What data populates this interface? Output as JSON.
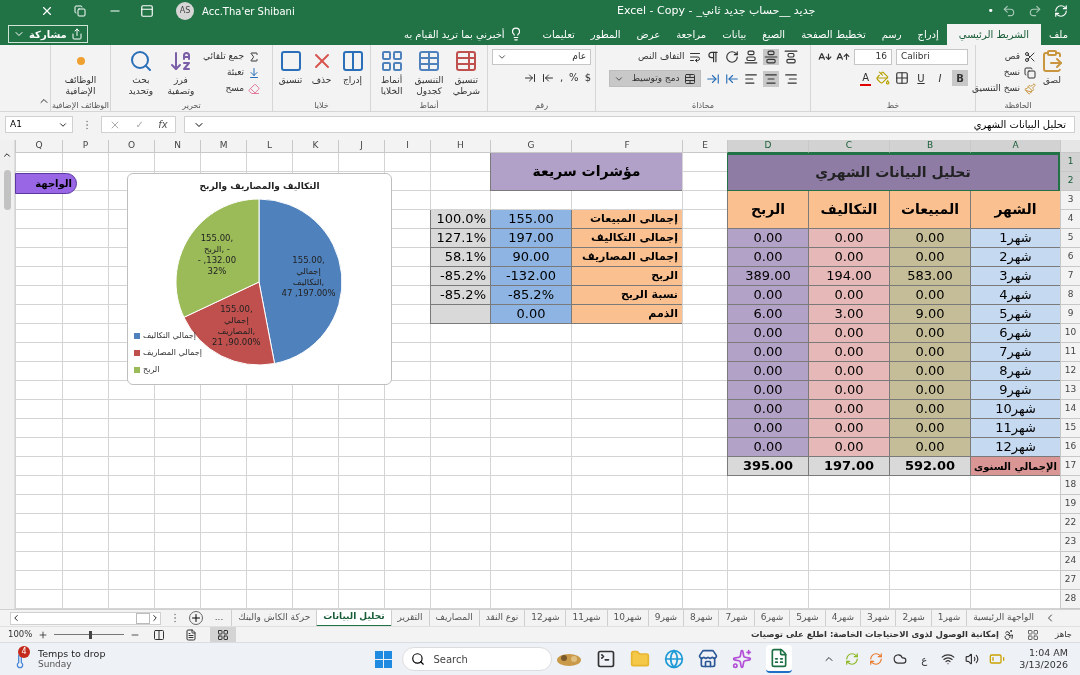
{
  "title_bar": {
    "app_title": "Excel - Copy -",
    "file_name": "جديد __حساب جديد ثاني_",
    "user_initials": "AS",
    "user_name": "Acc.Tha'er Shibani",
    "dot": "•"
  },
  "ribbon_tabs": [
    {
      "label": "ملف",
      "selected": false
    },
    {
      "label": "الشريط الرئيسي",
      "selected": true
    },
    {
      "label": "إدراج",
      "selected": false
    },
    {
      "label": "رسم",
      "selected": false
    },
    {
      "label": "تخطيط الصفحة",
      "selected": false
    },
    {
      "label": "الصيغ",
      "selected": false
    },
    {
      "label": "بيانات",
      "selected": false
    },
    {
      "label": "مراجعة",
      "selected": false
    },
    {
      "label": "عرض",
      "selected": false
    },
    {
      "label": "المطور",
      "selected": false
    },
    {
      "label": "تعليمات",
      "selected": false
    }
  ],
  "tell_me": "أخبرني بما تريد القيام به",
  "share_button": "مشاركة",
  "ribbon": {
    "clipboard": {
      "label": "الحافظة",
      "paste": "لصق",
      "cut": "قص",
      "copy": "نسخ",
      "format_painter": "نسخ التنسيق"
    },
    "font": {
      "label": "خط",
      "font_name": "Calibri",
      "font_size": "16",
      "bold": "B",
      "italic": "I",
      "underline": "U",
      "font_color": "A",
      "bold_selected": true
    },
    "alignment": {
      "label": "محاذاة",
      "wrap_text": "التفاف النص",
      "merge_center": "دمج وتوسيط",
      "merge_selected": true,
      "middle_selected": true,
      "center_selected": true
    },
    "number": {
      "label": "رقم",
      "format": "عام",
      "currency": "$",
      "percent": "%",
      "comma": ","
    },
    "styles": {
      "label": "أنماط",
      "conditional": "تنسيق شرطي",
      "as_table": "التنسيق كجدول",
      "cell_styles": "أنماط الخلايا"
    },
    "cells": {
      "label": "خلايا",
      "insert": "إدراج",
      "delete": "حذف",
      "format": "تنسيق"
    },
    "editing": {
      "label": "تحرير",
      "autosum": "جمع تلقائي",
      "fill": "تعبئة",
      "clear": "مسح",
      "sort_filter": "فرز وتصفية",
      "find_select": "بحث وتحديد"
    },
    "addins": {
      "label": "الوظائف الإضافية",
      "button": "الوظائف الإضافية"
    }
  },
  "formula_bar": {
    "name_box": "A1",
    "enter": "✓",
    "function": "fx",
    "formula": "تحليل البيانات الشهري"
  },
  "sheet": {
    "columns": [
      {
        "label": "A",
        "selected": true
      },
      {
        "label": "B",
        "selected": true
      },
      {
        "label": "C",
        "selected": true
      },
      {
        "label": "D",
        "selected": true
      },
      {
        "label": "E",
        "selected": false
      },
      {
        "label": "F",
        "selected": false
      },
      {
        "label": "G",
        "selected": false
      },
      {
        "label": "H",
        "selected": false
      },
      {
        "label": "I",
        "selected": false
      },
      {
        "label": "J",
        "selected": false
      },
      {
        "label": "K",
        "selected": false
      },
      {
        "label": "L",
        "selected": false
      },
      {
        "label": "M",
        "selected": false
      },
      {
        "label": "N",
        "selected": false
      },
      {
        "label": "O",
        "selected": false
      },
      {
        "label": "P",
        "selected": false
      },
      {
        "label": "Q",
        "selected": false
      }
    ],
    "rows": [
      {
        "label": "1",
        "selected": true
      },
      {
        "label": "2",
        "selected": true
      },
      {
        "label": "3",
        "selected": false
      },
      {
        "label": "4",
        "selected": false
      },
      {
        "label": "5",
        "selected": false
      },
      {
        "label": "6",
        "selected": false
      },
      {
        "label": "7",
        "selected": false
      },
      {
        "label": "8",
        "selected": false
      },
      {
        "label": "9",
        "selected": false
      },
      {
        "label": "10",
        "selected": false
      },
      {
        "label": "11",
        "selected": false
      },
      {
        "label": "12",
        "selected": false
      },
      {
        "label": "13",
        "selected": false
      },
      {
        "label": "14",
        "selected": false
      },
      {
        "label": "15",
        "selected": false
      },
      {
        "label": "16",
        "selected": false
      },
      {
        "label": "17",
        "selected": false
      },
      {
        "label": "18",
        "selected": false
      },
      {
        "label": "19",
        "selected": false
      },
      {
        "label": "22",
        "selected": false
      },
      {
        "label": "23",
        "selected": false
      },
      {
        "label": "24",
        "selected": false
      },
      {
        "label": "27",
        "selected": false
      },
      {
        "label": "28",
        "selected": false
      }
    ]
  },
  "monthly_table": {
    "title": "تحليل البيانات الشهري",
    "title_selected": true,
    "headers": [
      "الشهر",
      "المبيعات",
      "التكاليف",
      "الربح"
    ],
    "rows": [
      {
        "month": "شهر1",
        "sales": "0.00",
        "costs": "0.00",
        "profit": "0.00"
      },
      {
        "month": "شهر2",
        "sales": "0.00",
        "costs": "0.00",
        "profit": "0.00"
      },
      {
        "month": "شهر3",
        "sales": "583.00",
        "costs": "194.00",
        "profit": "389.00"
      },
      {
        "month": "شهر4",
        "sales": "0.00",
        "costs": "0.00",
        "profit": "0.00"
      },
      {
        "month": "شهر5",
        "sales": "9.00",
        "costs": "3.00",
        "profit": "6.00"
      },
      {
        "month": "شهر6",
        "sales": "0.00",
        "costs": "0.00",
        "profit": "0.00"
      },
      {
        "month": "شهر7",
        "sales": "0.00",
        "costs": "0.00",
        "profit": "0.00"
      },
      {
        "month": "شهر8",
        "sales": "0.00",
        "costs": "0.00",
        "profit": "0.00"
      },
      {
        "month": "شهر9",
        "sales": "0.00",
        "costs": "0.00",
        "profit": "0.00"
      },
      {
        "month": "شهر10",
        "sales": "0.00",
        "costs": "0.00",
        "profit": "0.00"
      },
      {
        "month": "شهر11",
        "sales": "0.00",
        "costs": "0.00",
        "profit": "0.00"
      },
      {
        "month": "شهر12",
        "sales": "0.00",
        "costs": "0.00",
        "profit": "0.00"
      }
    ],
    "total": {
      "label": "الإجمالي السنوى",
      "sales": "592.00",
      "costs": "197.00",
      "profit": "395.00"
    }
  },
  "quick_indicators": {
    "title": "مؤشرات سريعة",
    "rows": [
      {
        "label": "إجمالى المبيعات",
        "value": "155.00",
        "percent": "100.0%"
      },
      {
        "label": "إجمالى التكاليف",
        "value": "197.00",
        "percent": "127.1%"
      },
      {
        "label": "إجمالى المصاريف",
        "value": "90.00",
        "percent": "58.1%"
      },
      {
        "label": "الربح",
        "value": "-132.00",
        "percent": "-85.2%"
      },
      {
        "label": "نسبة الربح",
        "value": "-85.2%",
        "percent": "-85.2%"
      },
      {
        "label": "الذمم",
        "value": "0.00"
      }
    ]
  },
  "nav_button": "الواجهة",
  "chart": {
    "chart_data": {
      "type": "pie",
      "title": "التكاليف والمصاريف والربح",
      "legend": "bottom-left",
      "categories": [
        "إجمالي التكاليف",
        "إجمالي المصاريف",
        "الربح"
      ],
      "values": [
        47,
        21,
        32
      ],
      "colors": [
        "#4f81bd",
        "#c0504d",
        "#9bbb59"
      ],
      "value_labels": [
        [
          "155.00,",
          "إجمالي",
          "التكاليف,",
          "47 ,197.00%"
        ],
        [
          "155.00,",
          "إجمالي",
          "المصاريف,",
          "21 ,90.00%"
        ],
        [
          "155.00,",
          "الربح, -",
          "- ,132.00",
          "32%"
        ]
      ]
    }
  },
  "sheet_tabs": [
    {
      "label": "الواجهة الرئيسية",
      "selected": false
    },
    {
      "label": "شهر1",
      "selected": false
    },
    {
      "label": "شهر2",
      "selected": false
    },
    {
      "label": "شهر3",
      "selected": false
    },
    {
      "label": "شهر4",
      "selected": false
    },
    {
      "label": "شهر5",
      "selected": false
    },
    {
      "label": "شهر6",
      "selected": false
    },
    {
      "label": "شهر7",
      "selected": false
    },
    {
      "label": "شهر8",
      "selected": false
    },
    {
      "label": "شهر9",
      "selected": false
    },
    {
      "label": "شهر10",
      "selected": false
    },
    {
      "label": "شهر11",
      "selected": false
    },
    {
      "label": "شهر12",
      "selected": false
    },
    {
      "label": "نوع النقد",
      "selected": false
    },
    {
      "label": "المصاريف",
      "selected": false
    },
    {
      "label": "التقرير",
      "selected": false
    },
    {
      "label": "تحليل البيانات",
      "selected": true
    },
    {
      "label": "حركة الكاش والبنك",
      "selected": false
    }
  ],
  "more_tabs": "...",
  "status_bar": {
    "mode": "جاهز",
    "accessibility": "إمكانية الوصول لذوى الاحتياجات الخاصة: اطلع على توصيات",
    "zoom": "100%",
    "zoom_slider": {
      "level": 0.5
    },
    "views": [
      {
        "selected": false
      },
      {
        "selected": false
      },
      {
        "selected": true
      }
    ]
  },
  "taskbar": {
    "weather_badge": "4",
    "weather_title": "Temps to drop",
    "weather_subtitle": "Sunday",
    "search": "Search",
    "ime": "ع",
    "time": "1:04 AM",
    "date": "3/13/2026",
    "excel_active": true
  }
}
